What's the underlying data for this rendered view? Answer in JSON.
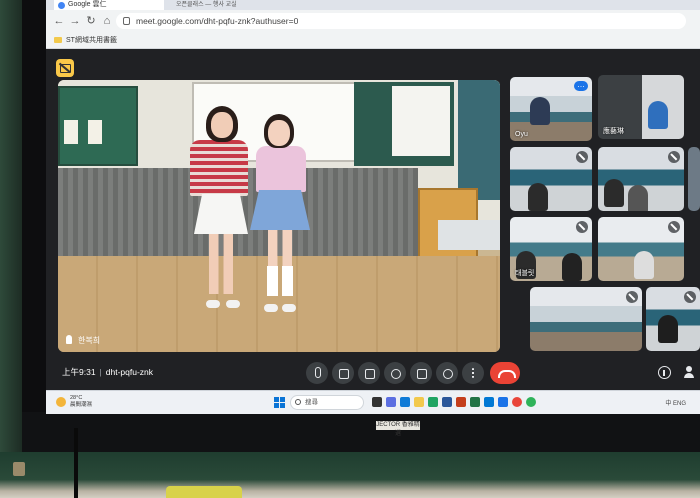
{
  "browser": {
    "tab_title": "Google 雲仁",
    "tab2_title": "오픈클래스 — 행사 교실",
    "url": "meet.google.com/dht-pqfu-znk?authuser=0",
    "bookmark": "ST網域共用書籤"
  },
  "meeting": {
    "presenter_name": "한복희",
    "tiles": [
      {
        "label": "Oyu"
      },
      {
        "label": "應藝琳"
      },
      {
        "label": ""
      },
      {
        "label": ""
      },
      {
        "label": ""
      },
      {
        "label": "태블릿"
      },
      {
        "label": ""
      },
      {
        "label": ""
      },
      {
        "label": ""
      }
    ]
  },
  "controls": {
    "time": "上午9:31",
    "separator": "|",
    "meeting_code": "dht-pqfu-znk"
  },
  "taskbar": {
    "weather_temp": "28°C",
    "weather_desc": "晨間潮濕",
    "search_placeholder": "搜尋",
    "tray_text": "中 ENG"
  },
  "monitor": {
    "brand_label": "JECTOR 香雅精選"
  },
  "colors": {
    "end_call": "#ea4335",
    "meet_bg": "#202124",
    "cam_badge": "#f9c849"
  }
}
